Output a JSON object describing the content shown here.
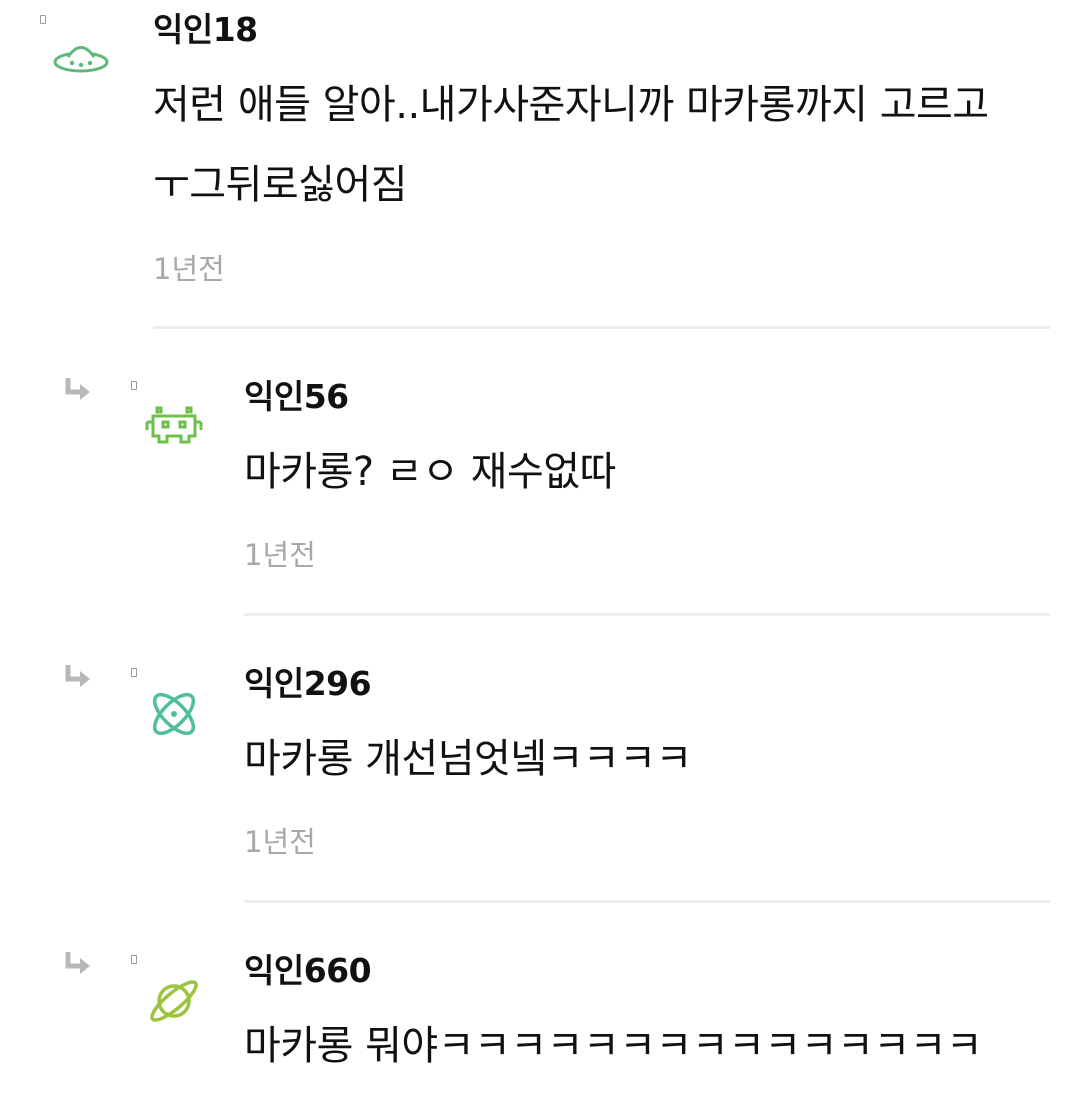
{
  "comments": [
    {
      "username": "익인18",
      "body_lines": [
        "저런 애들 알아..내가사준자니까 마카롱까지 고르고",
        "ㅜ그뒤로싫어짐"
      ],
      "time": "1년전",
      "avatar_icon": "ufo-icon",
      "avatar_color": "#5db87a",
      "is_reply": false
    },
    {
      "username": "익인56",
      "body_lines": [
        "마카롱? ㄹㅇ 재수없따"
      ],
      "time": "1년전",
      "avatar_icon": "space-invader-icon",
      "avatar_color": "#6cc04a",
      "is_reply": true
    },
    {
      "username": "익인296",
      "body_lines": [
        "마카롱 개선넘엇넼ㅋㅋㅋㅋ"
      ],
      "time": "1년전",
      "avatar_icon": "atom-icon",
      "avatar_color": "#4fbf9a",
      "is_reply": true
    },
    {
      "username": "익인660",
      "body_lines": [
        "마카롱 뭐야ㅋㅋㅋㅋㅋㅋㅋㅋㅋㅋㅋㅋㅋㅋㅋ"
      ],
      "time": "",
      "avatar_icon": "planet-icon",
      "avatar_color": "#9cc43c",
      "is_reply": true
    }
  ]
}
